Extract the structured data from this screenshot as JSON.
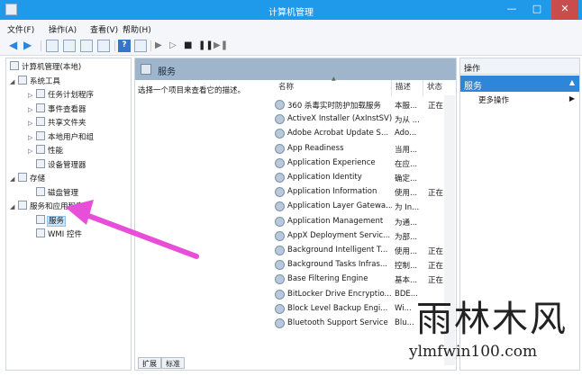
{
  "window": {
    "title": "计算机管理",
    "minimize": "—",
    "maximize": "□",
    "close": "✕"
  },
  "menu": [
    "文件(F)",
    "操作(A)",
    "查看(V)",
    "帮助(H)"
  ],
  "toolbar": {
    "help": "?"
  },
  "tree": [
    {
      "label": "计算机管理(本地)",
      "level": 0,
      "expander": ""
    },
    {
      "label": "系统工具",
      "level": 1,
      "expander": "◢"
    },
    {
      "label": "任务计划程序",
      "level": 2,
      "expander": "▷"
    },
    {
      "label": "事件查看器",
      "level": 2,
      "expander": "▷"
    },
    {
      "label": "共享文件夹",
      "level": 2,
      "expander": "▷"
    },
    {
      "label": "本地用户和组",
      "level": 2,
      "expander": "▷"
    },
    {
      "label": "性能",
      "level": 2,
      "expander": "▷"
    },
    {
      "label": "设备管理器",
      "level": 2,
      "expander": ""
    },
    {
      "label": "存储",
      "level": 1,
      "expander": "◢"
    },
    {
      "label": "磁盘管理",
      "level": 2,
      "expander": ""
    },
    {
      "label": "服务和应用程序",
      "level": 1,
      "expander": "◢"
    },
    {
      "label": "服务",
      "level": 2,
      "expander": "",
      "selected": true
    },
    {
      "label": "WMI 控件",
      "level": 2,
      "expander": ""
    }
  ],
  "center": {
    "header": "服务",
    "description": "选择一个项目来查看它的描述。",
    "columns": {
      "name": "名称",
      "desc": "描述",
      "status": "状态"
    },
    "sort_caret": "▲",
    "services": [
      {
        "name": "360 杀毒实时防护加载服务",
        "desc": "本服...",
        "status": "正在..."
      },
      {
        "name": "ActiveX Installer (AxInstSV)",
        "desc": "为从 ...",
        "status": ""
      },
      {
        "name": "Adobe Acrobat Update S...",
        "desc": "Ado...",
        "status": ""
      },
      {
        "name": "App Readiness",
        "desc": "当用...",
        "status": ""
      },
      {
        "name": "Application Experience",
        "desc": "在应...",
        "status": ""
      },
      {
        "name": "Application Identity",
        "desc": "确定...",
        "status": ""
      },
      {
        "name": "Application Information",
        "desc": "使用...",
        "status": "正在..."
      },
      {
        "name": "Application Layer Gatewa...",
        "desc": "为 In...",
        "status": ""
      },
      {
        "name": "Application Management",
        "desc": "为通...",
        "status": ""
      },
      {
        "name": "AppX Deployment Servic...",
        "desc": "为部...",
        "status": ""
      },
      {
        "name": "Background Intelligent T...",
        "desc": "使用...",
        "status": "正在..."
      },
      {
        "name": "Background Tasks Infras...",
        "desc": "控制...",
        "status": "正在..."
      },
      {
        "name": "Base Filtering Engine",
        "desc": "基本...",
        "status": "正在..."
      },
      {
        "name": "BitLocker Drive Encryptio...",
        "desc": "BDE...",
        "status": ""
      },
      {
        "name": "Block Level Backup Engi...",
        "desc": "Wi...",
        "status": ""
      },
      {
        "name": "Bluetooth Support Service",
        "desc": "Blu...",
        "status": ""
      }
    ],
    "tabs": [
      "扩展",
      "标准"
    ]
  },
  "actions": {
    "title": "操作",
    "section": "服务",
    "section_caret": "▲",
    "more": "更多操作",
    "more_arrow": "▶"
  },
  "watermark": {
    "brand": "雨林木风",
    "url": "ylmfwin100.com"
  },
  "colors": {
    "titlebar": "#1f9aeb",
    "accent": "#2d86d9",
    "arrow": "#e84fd9"
  }
}
